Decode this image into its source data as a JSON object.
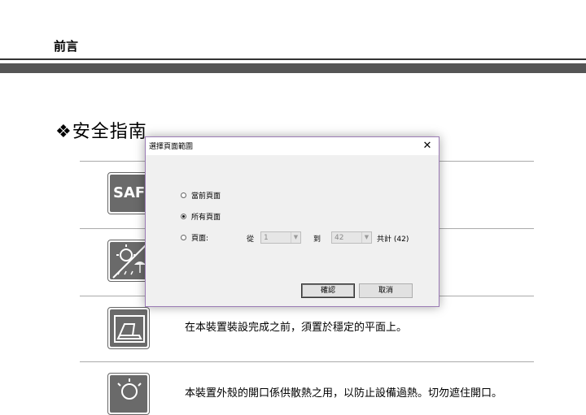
{
  "document": {
    "header": "前言",
    "section_title": "❖安全指南",
    "rows": [
      {
        "icon": "safety-sign-icon",
        "text": ""
      },
      {
        "icon": "weather-hazard-icon",
        "text": ""
      },
      {
        "icon": "laptop-on-surface-icon",
        "text": "在本裝置裝設完成之前，須置於穩定的平面上。"
      },
      {
        "icon": "heat-vent-icon",
        "text": "本裝置外殼的開口係供散熱之用，以防止設備過熱。切勿遮住開口。"
      }
    ],
    "row1_icon_text": "SAFE"
  },
  "dialog": {
    "title": "選擇頁面範圍",
    "close_glyph": "✕",
    "options": {
      "current": "當前頁面",
      "all": "所有頁面",
      "pages": "頁面:"
    },
    "selected": "all",
    "from_label": "從",
    "from_value": "1",
    "to_label": "到",
    "to_value": "42",
    "total_label": "共計 (42)",
    "ok_label": "確認",
    "cancel_label": "取消"
  },
  "colors": {
    "dialog_border": "#9b7bb5",
    "dialog_bg": "#f0f0f0",
    "rule": "#555555"
  }
}
